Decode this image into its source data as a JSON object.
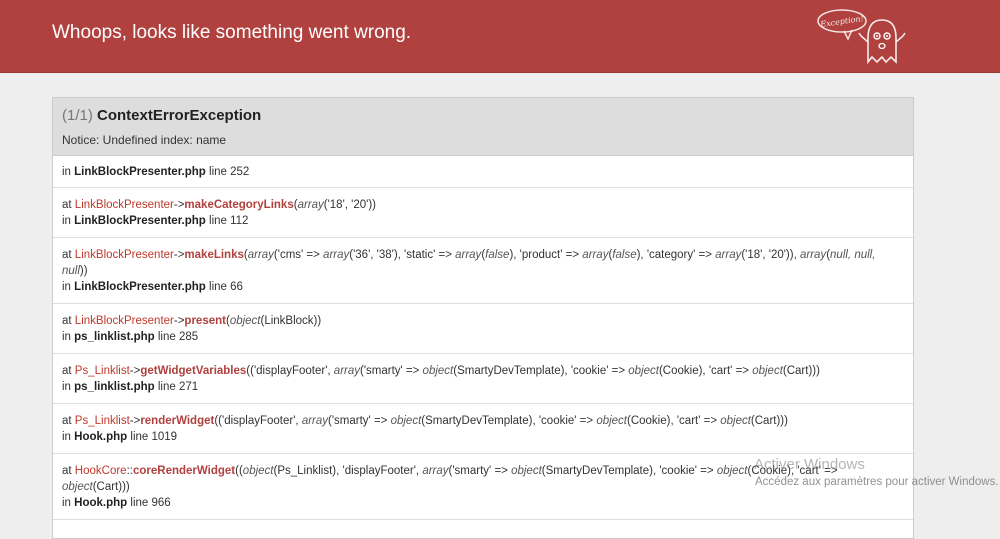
{
  "header": {
    "title": "Whoops, looks like something went wrong."
  },
  "logo": {
    "bubble_text": "Exception!"
  },
  "exception": {
    "count": "(1/1)",
    "name": "ContextErrorException",
    "message": "Notice: Undefined index: name"
  },
  "trace": [
    {
      "in": "in",
      "file": "LinkBlockPresenter.php",
      "line": "line 252"
    },
    {
      "at": "at",
      "class": "LinkBlockPresenter",
      "sep": "->",
      "func": "makeCategoryLinks",
      "args": [
        {
          "t": "i",
          "v": "array"
        },
        {
          "t": "p",
          "v": "('18', '20'))"
        }
      ],
      "in": "in",
      "file": "LinkBlockPresenter.php",
      "line": "line 112"
    },
    {
      "at": "at",
      "class": "LinkBlockPresenter",
      "sep": "->",
      "func": "makeLinks",
      "args": [
        {
          "t": "i",
          "v": "array"
        },
        {
          "t": "p",
          "v": "('cms' => "
        },
        {
          "t": "i",
          "v": "array"
        },
        {
          "t": "p",
          "v": "('36', '38'), 'static' => "
        },
        {
          "t": "i",
          "v": "array"
        },
        {
          "t": "p",
          "v": "("
        },
        {
          "t": "i",
          "v": "false"
        },
        {
          "t": "p",
          "v": "), 'product' => "
        },
        {
          "t": "i",
          "v": "array"
        },
        {
          "t": "p",
          "v": "("
        },
        {
          "t": "i",
          "v": "false"
        },
        {
          "t": "p",
          "v": "), 'category' => "
        },
        {
          "t": "i",
          "v": "array"
        },
        {
          "t": "p",
          "v": "('18', '20')), "
        },
        {
          "t": "i",
          "v": "array"
        },
        {
          "t": "p",
          "v": "("
        },
        {
          "t": "i",
          "v": "null, null, null"
        },
        {
          "t": "p",
          "v": "))"
        }
      ],
      "in": "in",
      "file": "LinkBlockPresenter.php",
      "line": "line 66"
    },
    {
      "at": "at",
      "class": "LinkBlockPresenter",
      "sep": "->",
      "func": "present",
      "args": [
        {
          "t": "i",
          "v": "object"
        },
        {
          "t": "p",
          "v": "(LinkBlock))"
        }
      ],
      "in": "in",
      "file": "ps_linklist.php",
      "line": "line 285"
    },
    {
      "at": "at",
      "class": "Ps_Linklist",
      "sep": "->",
      "func": "getWidgetVariables",
      "args": [
        {
          "t": "p",
          "v": "('displayFooter', "
        },
        {
          "t": "i",
          "v": "array"
        },
        {
          "t": "p",
          "v": "('smarty' => "
        },
        {
          "t": "i",
          "v": "object"
        },
        {
          "t": "p",
          "v": "(SmartyDevTemplate), 'cookie' => "
        },
        {
          "t": "i",
          "v": "object"
        },
        {
          "t": "p",
          "v": "(Cookie), 'cart' => "
        },
        {
          "t": "i",
          "v": "object"
        },
        {
          "t": "p",
          "v": "(Cart)))"
        }
      ],
      "in": "in",
      "file": "ps_linklist.php",
      "line": "line 271"
    },
    {
      "at": "at",
      "class": "Ps_Linklist",
      "sep": "->",
      "func": "renderWidget",
      "args": [
        {
          "t": "p",
          "v": "('displayFooter', "
        },
        {
          "t": "i",
          "v": "array"
        },
        {
          "t": "p",
          "v": "('smarty' => "
        },
        {
          "t": "i",
          "v": "object"
        },
        {
          "t": "p",
          "v": "(SmartyDevTemplate), 'cookie' => "
        },
        {
          "t": "i",
          "v": "object"
        },
        {
          "t": "p",
          "v": "(Cookie), 'cart' => "
        },
        {
          "t": "i",
          "v": "object"
        },
        {
          "t": "p",
          "v": "(Cart)))"
        }
      ],
      "in": "in",
      "file": "Hook.php",
      "line": "line 1019"
    },
    {
      "at": "at",
      "class": "HookCore",
      "sep": "::",
      "func": "coreRenderWidget",
      "args": [
        {
          "t": "p",
          "v": "("
        },
        {
          "t": "i",
          "v": "object"
        },
        {
          "t": "p",
          "v": "(Ps_Linklist), 'displayFooter', "
        },
        {
          "t": "i",
          "v": "array"
        },
        {
          "t": "p",
          "v": "('smarty' => "
        },
        {
          "t": "i",
          "v": "object"
        },
        {
          "t": "p",
          "v": "(SmartyDevTemplate), 'cookie' => "
        },
        {
          "t": "i",
          "v": "object"
        },
        {
          "t": "p",
          "v": "(Cookie), 'cart' => "
        },
        {
          "t": "i",
          "v": "object"
        },
        {
          "t": "p",
          "v": "(Cart)))"
        }
      ],
      "in": "in",
      "file": "Hook.php",
      "line": "line 966"
    }
  ],
  "watermark": {
    "title": "Activer Windows",
    "subtitle": "Accédez aux paramètres pour activer Windows."
  },
  "colors": {
    "header_bg": "#b0413e",
    "class_name": "#c0392b",
    "function_name": "#b0413e",
    "panel_head_bg": "#dddddd"
  }
}
